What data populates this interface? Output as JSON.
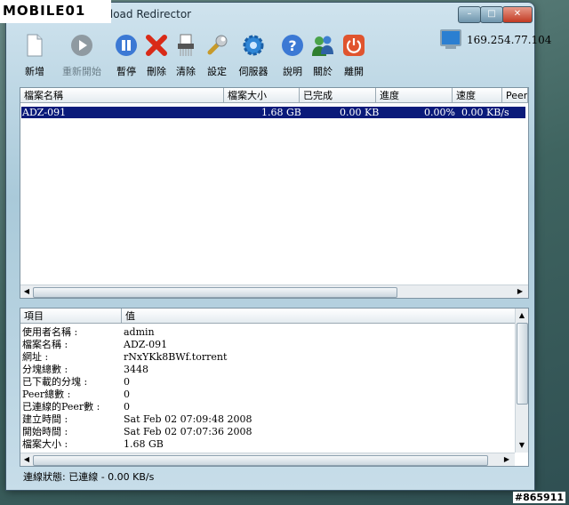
{
  "window": {
    "title": "Synology Download Redirector"
  },
  "logo_text": "MOBILE01",
  "toolbar": [
    {
      "id": "add",
      "label": "新增",
      "icon": "new-document-icon",
      "disabled": false
    },
    {
      "id": "restart",
      "label": "重新開始",
      "icon": "play-icon",
      "disabled": true
    },
    {
      "id": "pause",
      "label": "暫停",
      "icon": "pause-icon",
      "disabled": false
    },
    {
      "id": "delete",
      "label": "刪除",
      "icon": "red-x-icon",
      "disabled": false
    },
    {
      "id": "clear",
      "label": "清除",
      "icon": "shredder-icon",
      "disabled": false
    },
    {
      "id": "settings",
      "label": "設定",
      "icon": "wrench-icon",
      "disabled": false
    },
    {
      "id": "server",
      "label": "伺服器",
      "icon": "gear-icon",
      "disabled": false
    },
    {
      "id": "help",
      "label": "說明",
      "icon": "help-icon",
      "disabled": false
    },
    {
      "id": "about",
      "label": "關於",
      "icon": "users-icon",
      "disabled": false
    },
    {
      "id": "exit",
      "label": "離開",
      "icon": "power-icon",
      "disabled": false
    }
  ],
  "server_ip": "169.254.77.104",
  "download_table": {
    "columns": [
      "檔案名稱",
      "檔案大小",
      "已完成",
      "進度",
      "速度",
      "Peers"
    ],
    "rows": [
      {
        "name": "ADZ-091",
        "size": "1.68 GB",
        "completed": "0.00 KB",
        "progress": "0.00%",
        "speed": "0.00 KB/s"
      }
    ]
  },
  "details_table": {
    "columns": [
      "項目",
      "值"
    ],
    "rows": [
      {
        "key": "使用者名稱 :",
        "value": "admin"
      },
      {
        "key": "檔案名稱 :",
        "value": "ADZ-091"
      },
      {
        "key": "網址 :",
        "value": "rNxYKk8BWf.torrent"
      },
      {
        "key": "分塊總數 :",
        "value": "3448"
      },
      {
        "key": "已下載的分塊 :",
        "value": "0"
      },
      {
        "key": "Peer總數 :",
        "value": "0"
      },
      {
        "key": "已連線的Peer數 :",
        "value": "0"
      },
      {
        "key": "建立時間 :",
        "value": "Sat Feb 02 07:09:48 2008"
      },
      {
        "key": "開始時間 :",
        "value": "Sat Feb 02 07:07:36 2008"
      },
      {
        "key": "檔案大小 :",
        "value": "1.68 GB"
      }
    ]
  },
  "status": "連線狀態: 已連線 - 0.00 KB/s",
  "watermark": "#865911"
}
